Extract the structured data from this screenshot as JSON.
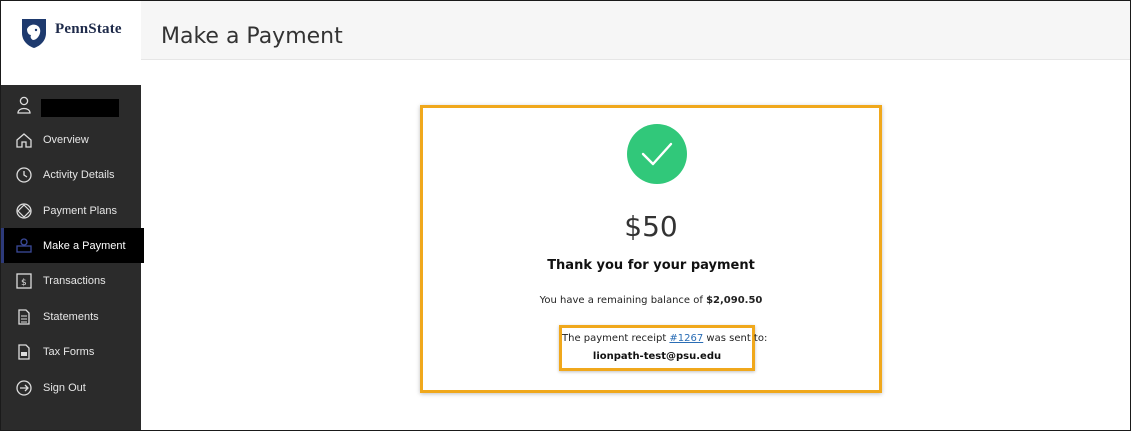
{
  "brand": {
    "name": "PennState"
  },
  "sidebar": {
    "items": [
      {
        "label": "Overview",
        "icon": "home-icon"
      },
      {
        "label": "Activity Details",
        "icon": "clock-icon"
      },
      {
        "label": "Payment Plans",
        "icon": "plans-icon"
      },
      {
        "label": "Make a Payment",
        "icon": "payment-icon",
        "active": true
      },
      {
        "label": "Transactions",
        "icon": "dollar-icon"
      },
      {
        "label": "Statements",
        "icon": "document-icon"
      },
      {
        "label": "Tax Forms",
        "icon": "tax-form-icon"
      },
      {
        "label": "Sign Out",
        "icon": "sign-out-icon"
      }
    ]
  },
  "header": {
    "title": "Make a Payment"
  },
  "confirmation": {
    "amount": "$50",
    "thanks": "Thank you for your payment",
    "balance_prefix": "You have a remaining balance of ",
    "balance_value": "$2,090.50",
    "receipt_prefix": "The payment receipt ",
    "receipt_number": "#1267",
    "receipt_suffix": " was sent to:",
    "receipt_email": "lionpath-test@psu.edu"
  },
  "colors": {
    "highlight": "#f0a81c",
    "success": "#31c87a",
    "sidebar_bg": "#2b2b2b",
    "active_bg": "#000000",
    "link": "#2a6db5"
  }
}
